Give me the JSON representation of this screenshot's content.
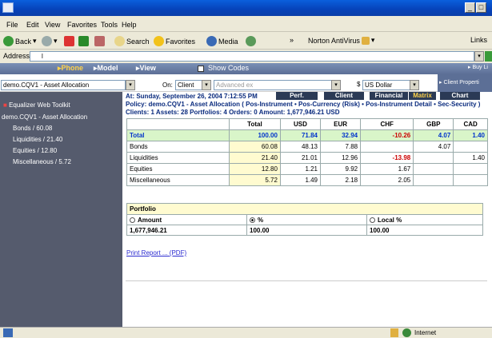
{
  "browser": {
    "menu": [
      "File",
      "Edit",
      "View",
      "Favorites",
      "Tools",
      "Help"
    ],
    "toolbar": {
      "back": "Back",
      "search": "Search",
      "favorites": "Favorites",
      "media": "Media",
      "norton": "Norton AntiVirus",
      "links": "Links"
    },
    "address_label": "Address",
    "address_value": "l",
    "status": "Internet"
  },
  "app": {
    "nav": {
      "phone": "▸Phone",
      "model": "▸Model",
      "view": "▸View",
      "show_codes": "Show Codes",
      "buy": "▸ Buy Li",
      "client_props": "▸ Client Properti"
    },
    "model_select": "demo.CQV1 - Asset Allocation",
    "on_label": "On:",
    "on_select": "Client",
    "advanced_select": "Advanced ex",
    "currency_dollar": "$",
    "currency_select": "US Dollar",
    "toolkit_title": "Equalizer Web Toolkit",
    "tree": [
      "demo.CQV1 - Asset Allocation",
      "Bonds / 60.08",
      "Liquidities / 21.40",
      "Equities / 12.80",
      "Miscellaneous / 5.72"
    ],
    "info": {
      "at": "At: Sunday, September 26, 2004  7:12:55 PM",
      "policy": "Policy: demo.CQV1 - Asset Allocation ( Pos-Instrument • Pos-Currency (Risk) • Pos-Instrument Detail • Sec-Security )",
      "clients": "Clients: 1 Assets: 28  Portfolios: 4  Orders: 0  Amount: 1,677,946.21 USD"
    },
    "tabs": [
      "Perf.",
      "Client",
      "Financial",
      "Matrix",
      "Chart"
    ],
    "table": {
      "headers": [
        "",
        "Total",
        "USD",
        "EUR",
        "CHF",
        "GBP",
        "CAD"
      ],
      "rows": [
        [
          "Total",
          "100.00",
          "71.84",
          "32.94",
          "-10.26",
          "4.07",
          "1.40"
        ],
        [
          "Bonds",
          "60.08",
          "48.13",
          "7.88",
          "",
          "4.07",
          ""
        ],
        [
          "Liquidities",
          "21.40",
          "21.01",
          "12.96",
          "-13.98",
          "",
          "1.40"
        ],
        [
          "Equities",
          "12.80",
          "1.21",
          "9.92",
          "1.67",
          "",
          ""
        ],
        [
          "Miscellaneous",
          "5.72",
          "1.49",
          "2.18",
          "2.05",
          "",
          ""
        ]
      ]
    },
    "portfolio": {
      "title": "Portfolio",
      "amount_label": "Amount",
      "pct_label": "%",
      "local_label": "Local %",
      "amount": "1,677,946.21",
      "pct": "100.00",
      "local": "100.00"
    },
    "print_link": "Print Report ... (PDF)"
  },
  "colors": {
    "accent": "#0a2b7e",
    "negative": "#cc0000",
    "total_row": "#d9f5c9",
    "highlight": "#fffbd0"
  }
}
